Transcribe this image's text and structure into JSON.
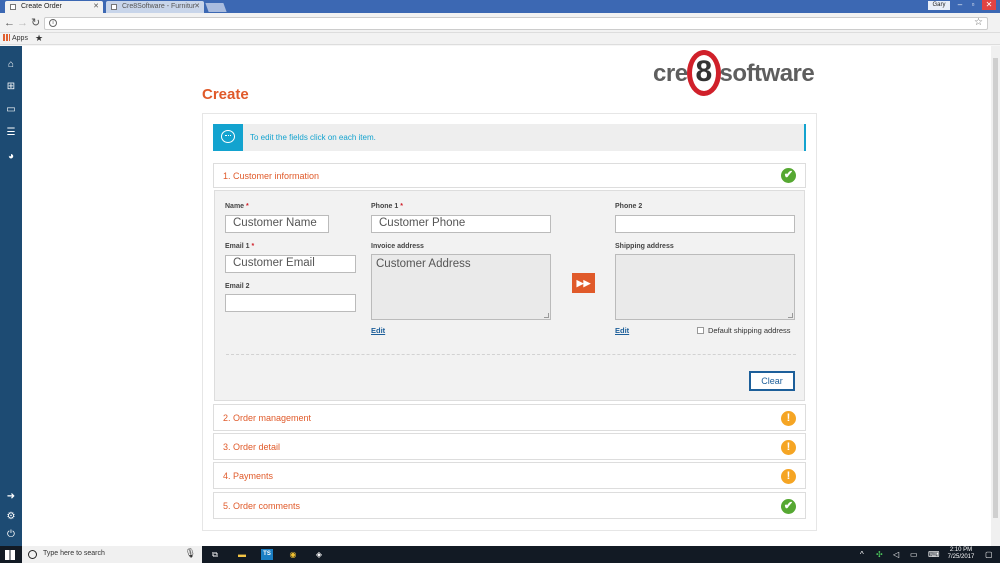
{
  "browser": {
    "tabs": [
      {
        "title": "Create Order",
        "active": true
      },
      {
        "title": "Cre8Software - Furnitur",
        "active": false
      }
    ],
    "user": "Gary",
    "bookmarks_apps": "Apps"
  },
  "brand": {
    "logo_left": "cre",
    "logo_eight": "8",
    "logo_right": "software",
    "accent": "#e05a2a",
    "info": "#13a3cf",
    "link": "#1d5f9a"
  },
  "page": {
    "title": "Create",
    "notice": "To edit the fields click on each item."
  },
  "sections": [
    {
      "label": "1. Customer information",
      "status": "ok",
      "icon": "✔"
    },
    {
      "label": "2. Order management",
      "status": "warn",
      "icon": "!"
    },
    {
      "label": "3. Order detail",
      "status": "warn",
      "icon": "!"
    },
    {
      "label": "4. Payments",
      "status": "warn",
      "icon": "!"
    },
    {
      "label": "5. Order comments",
      "status": "ok",
      "icon": "✔"
    }
  ],
  "form": {
    "name_label": "Name",
    "name_value": "Customer Name",
    "email1_label": "Email 1",
    "email1_value": "Customer Email",
    "email2_label": "Email 2",
    "email2_value": "",
    "phone1_label": "Phone 1",
    "phone1_value": "Customer Phone",
    "phone2_label": "Phone 2",
    "phone2_value": "",
    "invoice_label": "Invoice address",
    "invoice_value": "Customer Address",
    "shipping_label": "Shipping address",
    "shipping_value": "",
    "required_mark": "*",
    "edit_label": "Edit",
    "default_shipping_label": "Default shipping address",
    "default_shipping_checked": false,
    "copy_icon": "fast-forward-icon",
    "clear_label": "Clear"
  },
  "taskbar": {
    "search_placeholder": "Type here to search",
    "time": "2:10 PM",
    "date": "7/25/2017"
  }
}
